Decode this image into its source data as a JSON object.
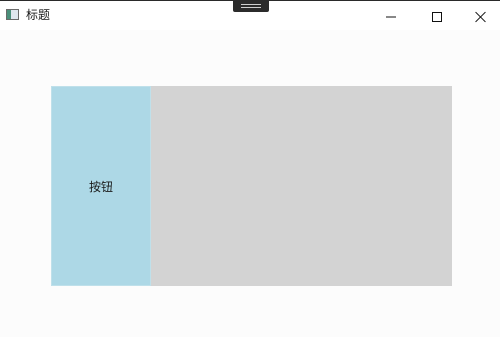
{
  "window": {
    "title": "标题",
    "icons": {
      "app": "window-app-icon",
      "minimize": "minimize-icon",
      "maximize": "maximize-icon",
      "close": "close-icon",
      "grip": "drag-grip-icon"
    }
  },
  "content": {
    "button_label": "按钮"
  },
  "colors": {
    "window_background": "#fcfcfc",
    "titlebar": "#ffffff",
    "panel": "#d3d3d3",
    "button": "#add8e6"
  }
}
